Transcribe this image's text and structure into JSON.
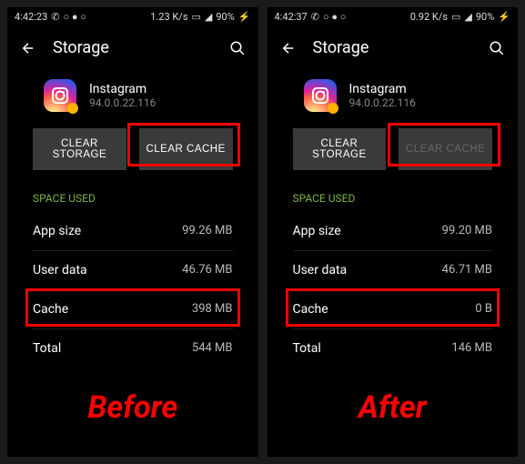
{
  "screens": [
    {
      "status": {
        "time": "4:42:23",
        "speed": "1.23 K/s",
        "battery": "90%"
      },
      "header": {
        "title": "Storage"
      },
      "app": {
        "name": "Instagram",
        "version": "94.0.0.22.116"
      },
      "actions": {
        "clear_storage": "CLEAR STORAGE",
        "clear_cache": "CLEAR CACHE",
        "cache_disabled": false
      },
      "section_label": "SPACE USED",
      "rows": {
        "app_size_label": "App size",
        "app_size_value": "99.26 MB",
        "user_data_label": "User data",
        "user_data_value": "46.76 MB",
        "cache_label": "Cache",
        "cache_value": "398 MB",
        "total_label": "Total",
        "total_value": "544 MB"
      },
      "caption": "Before"
    },
    {
      "status": {
        "time": "4:42:37",
        "speed": "0.92 K/s",
        "battery": "90%"
      },
      "header": {
        "title": "Storage"
      },
      "app": {
        "name": "Instagram",
        "version": "94.0.0.22.116"
      },
      "actions": {
        "clear_storage": "CLEAR STORAGE",
        "clear_cache": "CLEAR CACHE",
        "cache_disabled": true
      },
      "section_label": "SPACE USED",
      "rows": {
        "app_size_label": "App size",
        "app_size_value": "99.20 MB",
        "user_data_label": "User data",
        "user_data_value": "46.71 MB",
        "cache_label": "Cache",
        "cache_value": "0 B",
        "total_label": "Total",
        "total_value": "146 MB"
      },
      "caption": "After"
    }
  ]
}
